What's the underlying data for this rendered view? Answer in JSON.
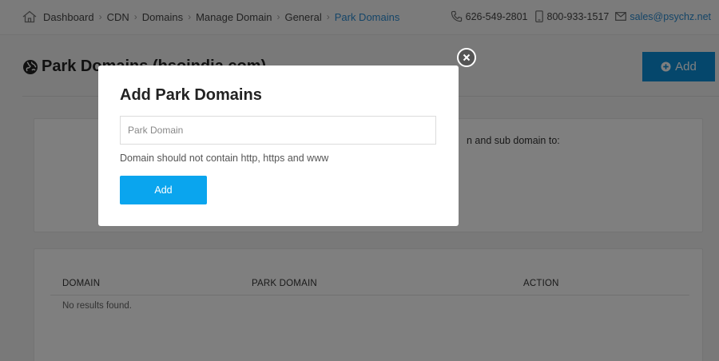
{
  "breadcrumb": {
    "items": [
      {
        "label": "Dashboard"
      },
      {
        "label": "CDN"
      },
      {
        "label": "Domains"
      },
      {
        "label": "Manage Domain"
      },
      {
        "label": "General"
      },
      {
        "label": "Park Domains"
      }
    ]
  },
  "contacts": {
    "phone": "626-549-2801",
    "mobile": "800-933-1517",
    "email": "sales@psychz.net"
  },
  "page": {
    "title": "Park Domains (hsoindia.com)",
    "add_label": "Add"
  },
  "info_card": {
    "text": "n and sub domain to:"
  },
  "table": {
    "columns": [
      "DOMAIN",
      "PARK DOMAIN",
      "ACTION"
    ],
    "empty_message": "No results found."
  },
  "modal": {
    "title": "Add Park Domains",
    "input_placeholder": "Park Domain",
    "input_value": "",
    "hint": "Domain should not contain http, https and www",
    "add_label": "Add"
  },
  "colors": {
    "accent": "#0a8fd9",
    "modal_button": "#0aa5ee",
    "link": "#2a8bd0"
  }
}
